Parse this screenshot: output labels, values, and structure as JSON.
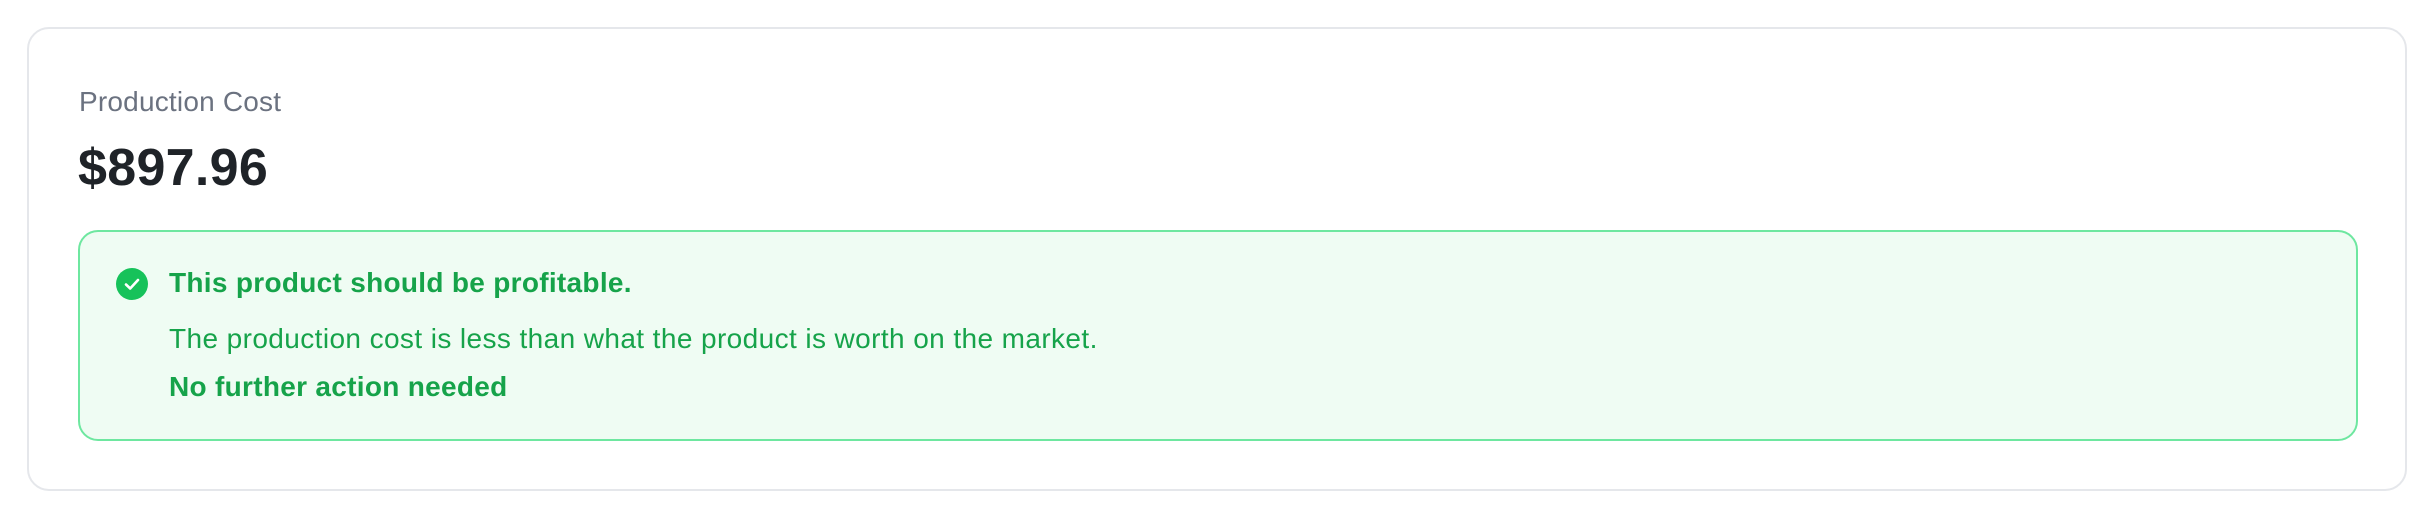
{
  "card": {
    "label": "Production Cost",
    "value": "$897.96"
  },
  "alert": {
    "status": "success",
    "icon": "check-circle-icon",
    "title": "This product should be profitable.",
    "description": "The production cost is less than what the product is worth on the market.",
    "action": "No further action needed"
  },
  "colors": {
    "success_text": "#16a34a",
    "success_icon": "#16c25a",
    "success_border": "#6ee7a0",
    "success_background": "#effcf3",
    "label_text": "#6b7280",
    "value_text": "#1f2328"
  }
}
